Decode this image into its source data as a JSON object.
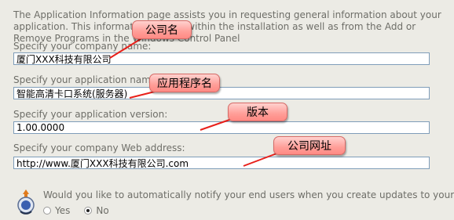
{
  "intro": {
    "line1": "The Application Information page assists you in requesting general information about your",
    "line2": "application. This information is used within the installation as well as from the Add or",
    "line3": "Remove Programs in the Windows Control Panel"
  },
  "fields": {
    "company_name": {
      "label": "Specify your company name:",
      "value": "厦门XXX科技有限公司"
    },
    "app_name": {
      "label": "Specify your application name:",
      "value": "智能高清卡口系统(服务器)"
    },
    "app_version": {
      "label": "Specify your application version:",
      "value": "1.00.0000"
    },
    "web_address": {
      "label": "Specify your company Web address:",
      "value": "http://www.厦门XXX科技有限公司.com"
    }
  },
  "notify": {
    "question": "Would you like to automatically notify your end users when you create updates to your",
    "yes_label": "Yes",
    "no_label": "No",
    "selected": "No"
  },
  "annotations": {
    "company_name": "公司名",
    "app_name": "应用程序名",
    "version": "版本",
    "web_address": "公司网址"
  },
  "colors": {
    "callout_fill": "#ff9e98",
    "arrow": "#e8201a",
    "field_border": "#7f9db9"
  }
}
